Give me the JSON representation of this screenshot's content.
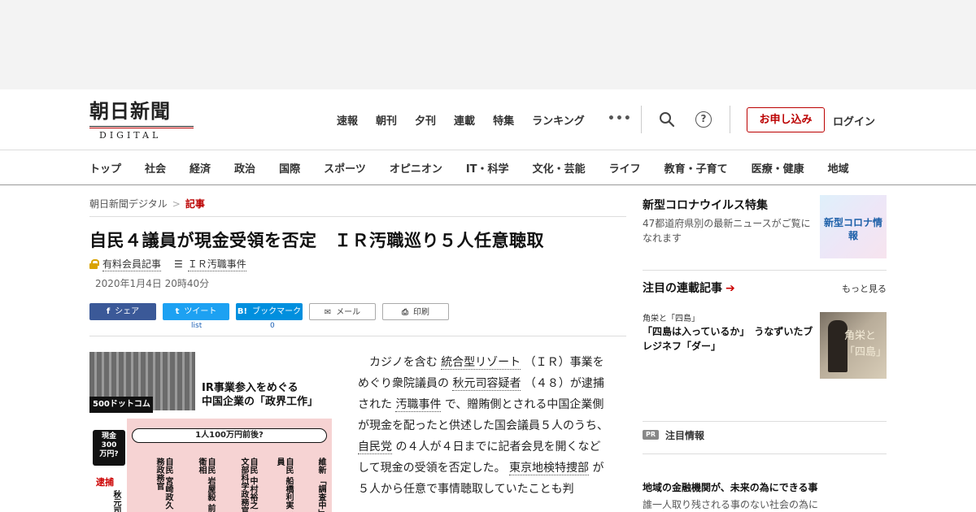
{
  "header": {
    "logo_jp": "朝日新聞",
    "logo_en": "DIGITAL",
    "nav": [
      "速報",
      "朝刊",
      "夕刊",
      "連載",
      "特集",
      "ランキング"
    ],
    "more": "•••",
    "apply_label": "お申し込み",
    "login_label": "ログイン",
    "help_glyph": "?"
  },
  "catnav": [
    "トップ",
    "社会",
    "経済",
    "政治",
    "国際",
    "スポーツ",
    "オピニオン",
    "IT・科学",
    "文化・芸能",
    "ライフ",
    "教育・子育て",
    "医療・健康",
    "地域"
  ],
  "breadcrumb": {
    "home": "朝日新聞デジタル",
    "sep": ">",
    "current": "記事"
  },
  "article": {
    "headline": "自民４議員が現金受領を否定　ＩＲ汚職巡り５人任意聴取",
    "paid_label": "有料会員記事",
    "series_label": "ＩＲ汚職事件",
    "date": "2020年1月4日 20時40分",
    "body_parts": [
      "カジノを含む",
      "統合型リゾート",
      "（ＩＲ）事業をめぐり衆院議員の",
      "秋元司容疑者",
      "（４８）が逮捕された",
      "汚職事件",
      "で、贈賄側とされる中国企業側が現金を配ったと供述した国会議員５人のうち、",
      "自民党",
      "の４人が４日までに記者会見を開くなどして現金の受領を否定した。",
      "東京地検特捜部",
      "が５人から任意で事情聴取していたことも判"
    ]
  },
  "share": {
    "facebook": "シェア",
    "twitter": "ツイート",
    "hatena": "ブックマーク",
    "mail": "メール",
    "print": "印刷",
    "twitter_count": "list",
    "hatena_count": "0",
    "fb_glyph": "f",
    "tw_glyph": "t",
    "hb_glyph": "B!",
    "mail_glyph": "✉",
    "print_glyph": "⎙"
  },
  "figure": {
    "title_line1": "IR事業参入をめぐる",
    "title_line2": "中国企業の「政界工作」",
    "company": "500ドットコム",
    "cash": [
      "現金",
      "300",
      "万円?"
    ],
    "per_person": "1人100万円前後?",
    "arrest": "逮捕",
    "arrest_name": "秋元司",
    "members": [
      "自民 宮崎政久 法務政務官",
      "自民 岩屋毅 前防衛相",
      "自民 中村裕之 前文部科学政務官",
      "自民 船橋利実 議員",
      "維新 「調査中」"
    ]
  },
  "sidebar": {
    "corona_title": "新型コロナウイルス特集",
    "corona_desc": "47都道府県別の最新ニュースがご覧になれます",
    "corona_img_text": "新型コロナ情報",
    "serial_title": "注目の連載記事",
    "more_label": "もっと見る",
    "serial_tag": "角栄と「四島」",
    "serial_item": "「四島は入っているか」　うなずいたブレジネフ「ダー」",
    "serial_img_text": "角栄と「四島」",
    "pr_badge": "PR",
    "pr_label": "注目情報",
    "pr_title": "地域の金融機関が、未来の為にできる事",
    "pr_desc": "誰一人取り残される事のない社会の為に"
  },
  "colors": {
    "accent": "#bb0000",
    "facebook": "#3b5998",
    "twitter": "#1da1f2",
    "hatena": "#008fde"
  }
}
